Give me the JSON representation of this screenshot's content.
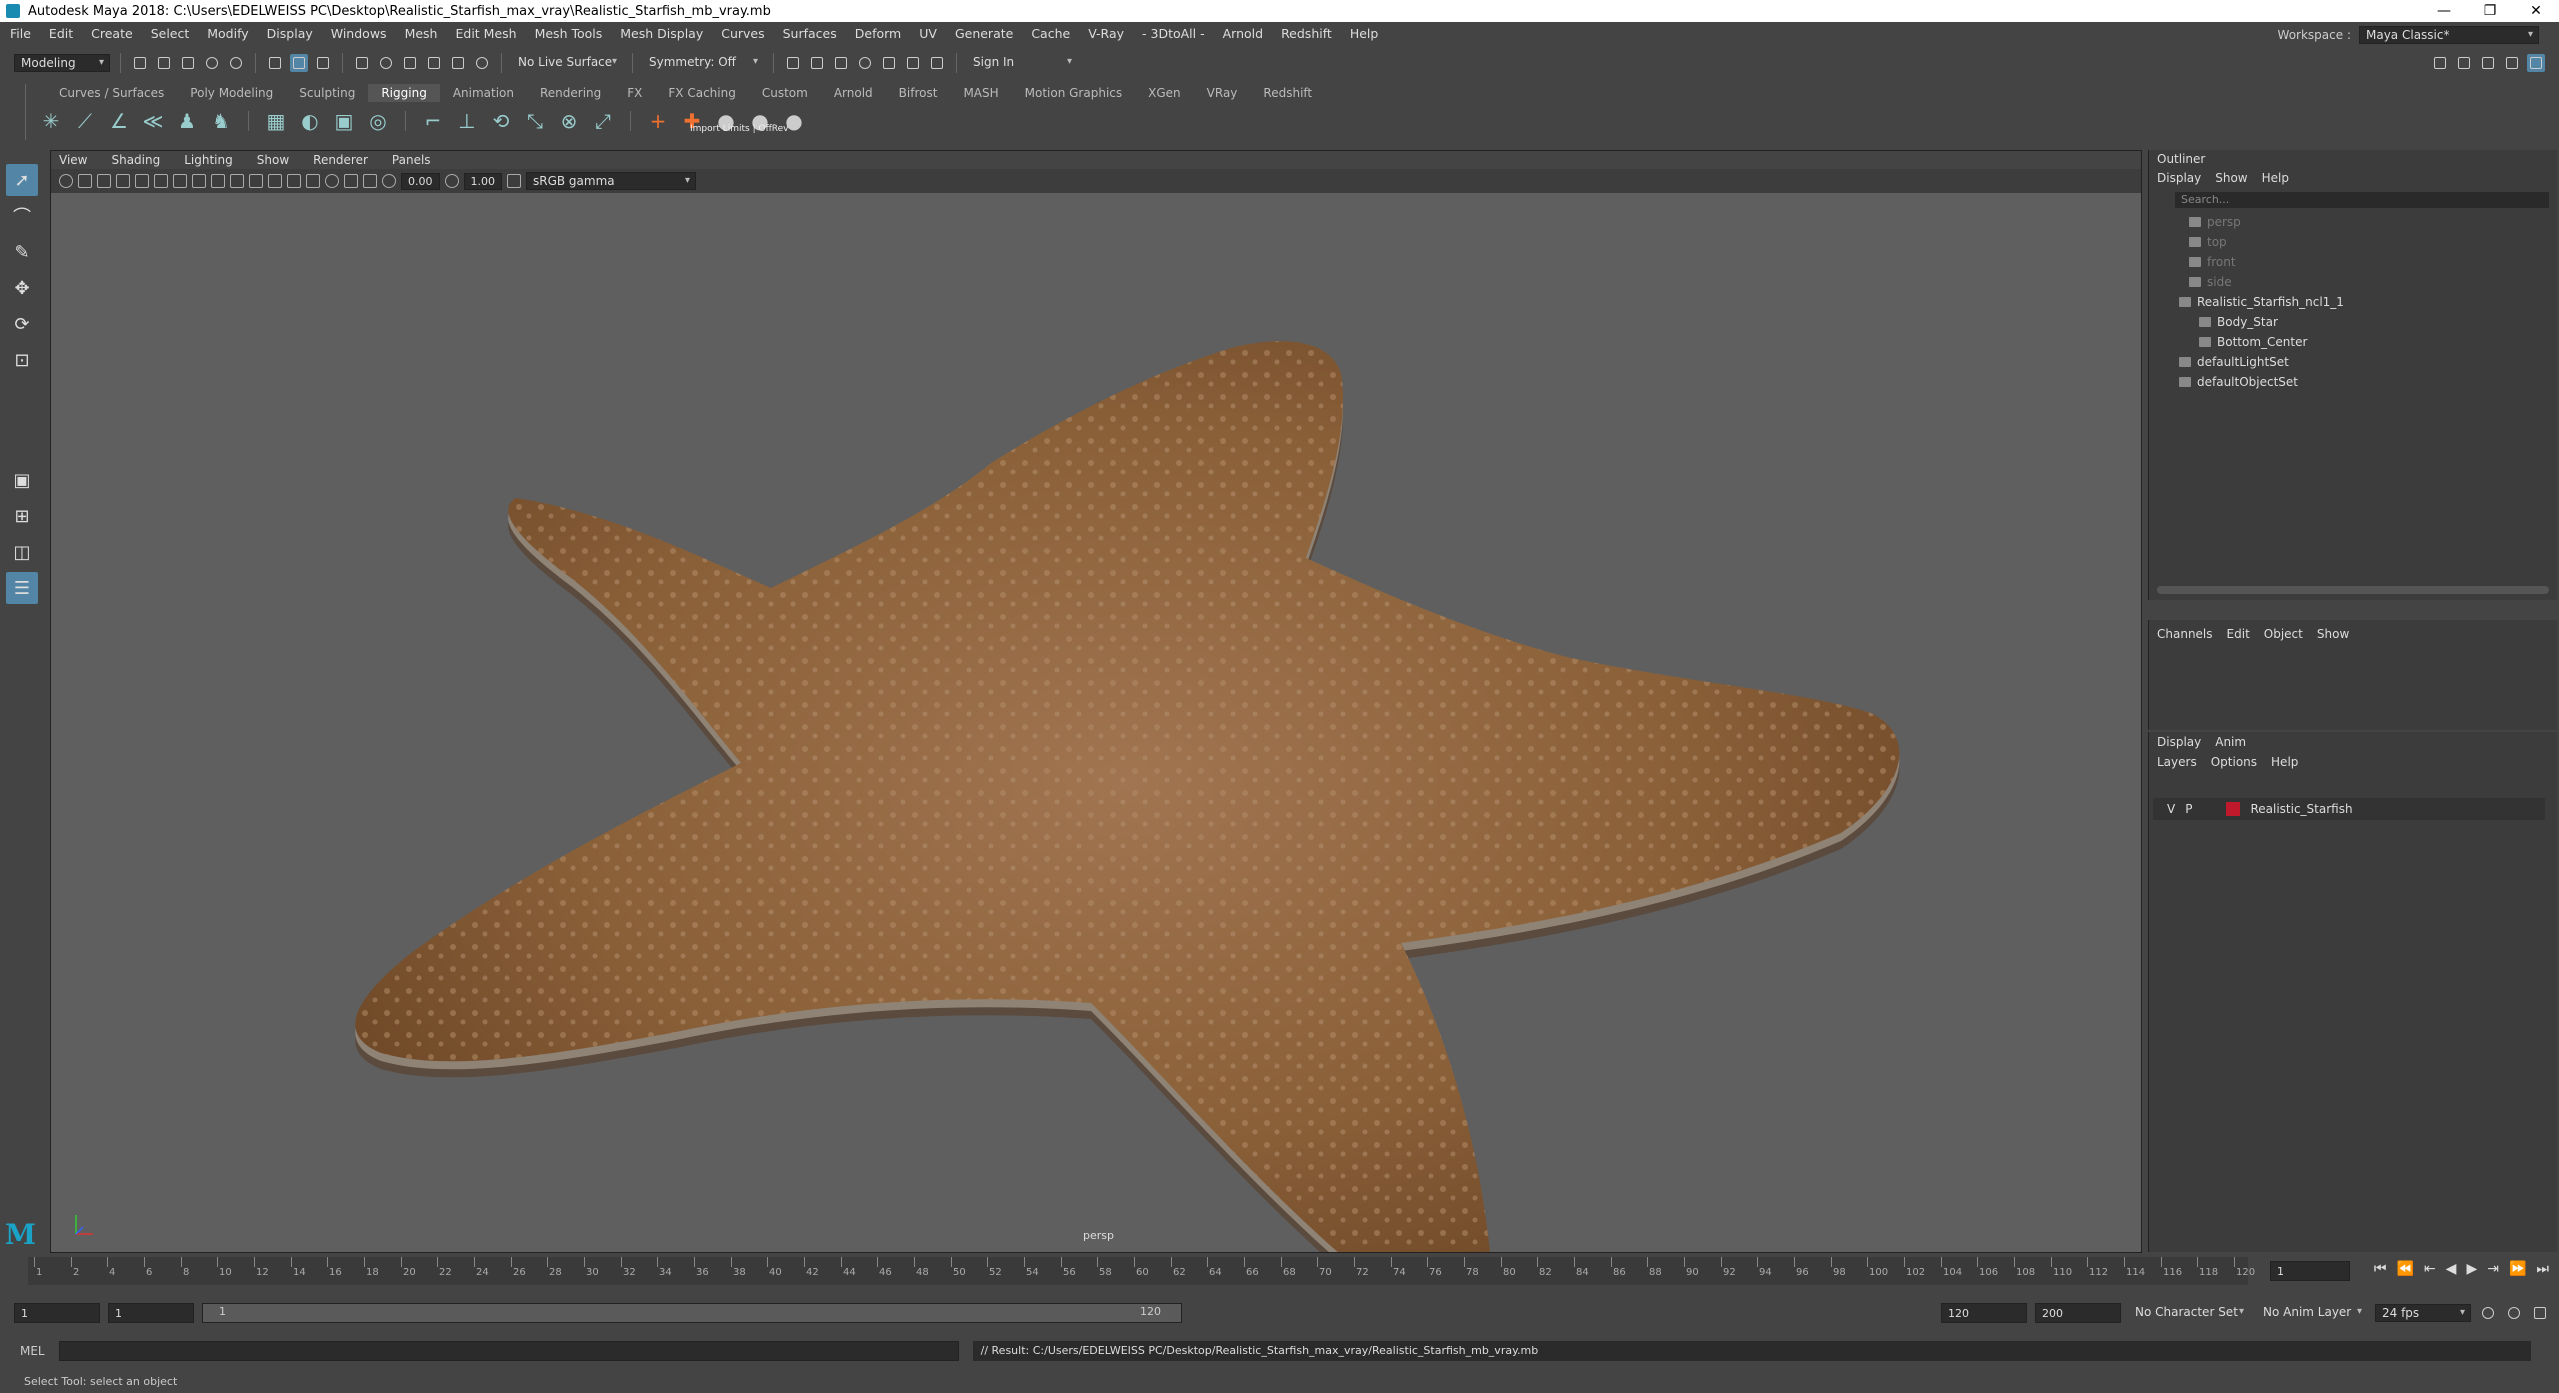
{
  "window": {
    "title": "Autodesk Maya 2018: C:\\Users\\EDELWEISS PC\\Desktop\\Realistic_Starfish_max_vray\\Realistic_Starfish_mb_vray.mb",
    "minimize": "—",
    "maximize": "❐",
    "close": "✕"
  },
  "menu": [
    "File",
    "Edit",
    "Create",
    "Select",
    "Modify",
    "Display",
    "Windows",
    "Mesh",
    "Edit Mesh",
    "Mesh Tools",
    "Mesh Display",
    "Curves",
    "Surfaces",
    "Deform",
    "UV",
    "Generate",
    "Cache",
    "V-Ray",
    "- 3DtoAll -",
    "Arnold",
    "Redshift",
    "Help"
  ],
  "workspace": {
    "label": "Workspace :",
    "value": "Maya Classic*"
  },
  "status": {
    "mode": "Modeling",
    "live_surface": "No Live Surface",
    "symmetry": "Symmetry: Off",
    "sign_in": "Sign In"
  },
  "shelf": {
    "tabs": [
      "Curves / Surfaces",
      "Poly Modeling",
      "Sculpting",
      "Rigging",
      "Animation",
      "Rendering",
      "FX",
      "FX Caching",
      "Custom",
      "Arnold",
      "Bifrost",
      "MASH",
      "Motion Graphics",
      "XGen",
      "VRay",
      "Redshift"
    ],
    "active": "Rigging",
    "tooltip": "Import Limits | OffRev"
  },
  "viewport": {
    "menu": [
      "View",
      "Shading",
      "Lighting",
      "Show",
      "Renderer",
      "Panels"
    ],
    "exposure": "0.00",
    "gamma": "1.00",
    "colorspace": "sRGB gamma",
    "camera": "persp"
  },
  "outliner": {
    "title": "Outliner",
    "menu": [
      "Display",
      "Show",
      "Help"
    ],
    "search_placeholder": "Search...",
    "items": [
      {
        "label": "persp",
        "dim": true,
        "indent": 1
      },
      {
        "label": "top",
        "dim": true,
        "indent": 1
      },
      {
        "label": "front",
        "dim": true,
        "indent": 1
      },
      {
        "label": "side",
        "dim": true,
        "indent": 1
      },
      {
        "label": "Realistic_Starfish_ncl1_1",
        "dim": false,
        "indent": 0
      },
      {
        "label": "Body_Star",
        "dim": false,
        "indent": 2
      },
      {
        "label": "Bottom_Center",
        "dim": false,
        "indent": 2
      },
      {
        "label": "defaultLightSet",
        "dim": false,
        "indent": 0
      },
      {
        "label": "defaultObjectSet",
        "dim": false,
        "indent": 0
      }
    ]
  },
  "channels": {
    "menu": [
      "Channels",
      "Edit",
      "Object",
      "Show"
    ]
  },
  "layers": {
    "tabs": [
      "Display",
      "Anim"
    ],
    "menu": [
      "Layers",
      "Options",
      "Help"
    ],
    "row": {
      "v": "V",
      "p": "P",
      "name": "Realistic_Starfish",
      "color": "#c0192c"
    }
  },
  "timeline": {
    "ticks": [
      "1",
      "2",
      "4",
      "6",
      "8",
      "10",
      "12",
      "14",
      "16",
      "18",
      "20",
      "22",
      "24",
      "26",
      "28",
      "30",
      "32",
      "34",
      "36",
      "38",
      "40",
      "42",
      "44",
      "46",
      "48",
      "50",
      "52",
      "54",
      "56",
      "58",
      "60",
      "62",
      "64",
      "66",
      "68",
      "70",
      "72",
      "74",
      "76",
      "78",
      "80",
      "82",
      "84",
      "86",
      "88",
      "90",
      "92",
      "94",
      "96",
      "98",
      "100",
      "102",
      "104",
      "106",
      "108",
      "110",
      "112",
      "114",
      "116",
      "118",
      "120"
    ],
    "current": "1"
  },
  "range": {
    "start": "1",
    "start2": "1",
    "range_start": "1",
    "range_end": "120",
    "end": "120",
    "end2": "200",
    "char_set": "No Character Set",
    "anim_layer": "No Anim Layer",
    "fps": "24 fps"
  },
  "cmd": {
    "lang": "MEL",
    "result": "// Result: C:/Users/EDELWEISS PC/Desktop/Realistic_Starfish_max_vray/Realistic_Starfish_mb_vray.mb"
  },
  "help": "Select Tool: select an object"
}
